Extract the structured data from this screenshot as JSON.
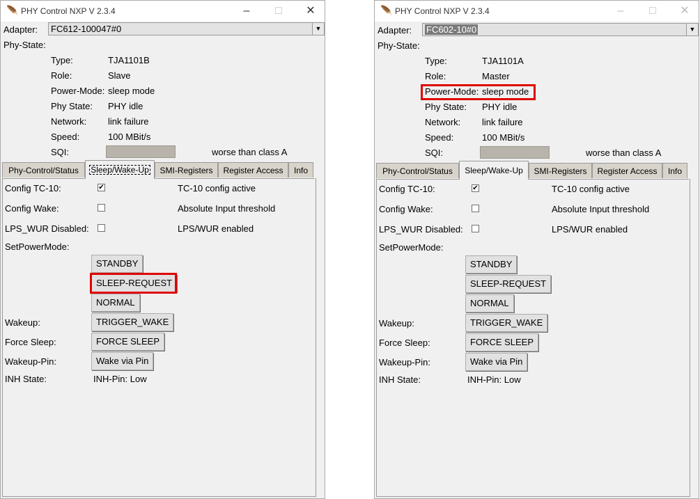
{
  "left": {
    "title": "PHY Control NXP V 2.3.4",
    "adapter_label": "Adapter:",
    "adapter_value": "FC612-100047#0",
    "phy_state_label": "Phy-State:",
    "type_label": "Type:",
    "type_value": "TJA1101B",
    "role_label": "Role:",
    "role_value": "Slave",
    "power_label": "Power-Mode:",
    "power_value": "sleep mode",
    "phystate_label": "Phy State:",
    "phystate_value": "PHY idle",
    "network_label": "Network:",
    "network_value": "link failure",
    "speed_label": "Speed:",
    "speed_value": "100 MBit/s",
    "sqi_label": "SQI:",
    "sqi_value": "worse than class A",
    "tabs": [
      "Phy-Control/Status",
      "Sleep/Wake-Up",
      "SMI-Registers",
      "Register Access",
      "Info"
    ],
    "config_tc10_label": "Config TC-10:",
    "config_tc10_status": "TC-10 config active",
    "config_wake_label": "Config Wake:",
    "config_wake_status": "Absolute Input threshold",
    "lps_label": "LPS_WUR Disabled:",
    "lps_status": "LPS/WUR enabled",
    "setpower_label": "SetPowerMode:",
    "btn_standby": "STANDBY",
    "btn_sleep_request": "SLEEP-REQUEST",
    "btn_normal": "NORMAL",
    "wakeup_label": "Wakeup:",
    "btn_trigger_wake": "TRIGGER_WAKE",
    "force_sleep_label": "Force Sleep:",
    "btn_force_sleep": "FORCE SLEEP",
    "wakeup_pin_label": "Wakeup-Pin:",
    "btn_wake_pin": "Wake via Pin",
    "inh_label": "INH State:",
    "inh_value": "INH-Pin: Low"
  },
  "right": {
    "title": "PHY Control NXP V 2.3.4",
    "adapter_label": "Adapter:",
    "adapter_value": "FC602-10#0",
    "phy_state_label": "Phy-State:",
    "type_label": "Type:",
    "type_value": "TJA1101A",
    "role_label": "Role:",
    "role_value": "Master",
    "power_label": "Power-Mode:",
    "power_value": "sleep mode",
    "phystate_label": "Phy State:",
    "phystate_value": "PHY idle",
    "network_label": "Network:",
    "network_value": "link failure",
    "speed_label": "Speed:",
    "speed_value": "100 MBit/s",
    "sqi_label": "SQI:",
    "sqi_value": "worse than class A",
    "tabs": [
      "Phy-Control/Status",
      "Sleep/Wake-Up",
      "SMI-Registers",
      "Register Access",
      "Info"
    ],
    "config_tc10_label": "Config TC-10:",
    "config_tc10_status": "TC-10 config active",
    "config_wake_label": "Config Wake:",
    "config_wake_status": "Absolute Input threshold",
    "lps_label": "LPS_WUR Disabled:",
    "lps_status": "LPS/WUR enabled",
    "setpower_label": "SetPowerMode:",
    "btn_standby": "STANDBY",
    "btn_sleep_request": "SLEEP-REQUEST",
    "btn_normal": "NORMAL",
    "wakeup_label": "Wakeup:",
    "btn_trigger_wake": "TRIGGER_WAKE",
    "force_sleep_label": "Force Sleep:",
    "btn_force_sleep": "FORCE SLEEP",
    "wakeup_pin_label": "Wakeup-Pin:",
    "btn_wake_pin": "Wake via Pin",
    "inh_label": "INH State:",
    "inh_value": "INH-Pin: Low"
  },
  "icons": {
    "app": "feather-icon",
    "minimize": "minimize-icon",
    "maximize": "maximize-icon",
    "close": "close-icon",
    "dropdown": "chevron-down-icon",
    "check": "checkmark-icon"
  },
  "colors": {
    "highlight": "#e00000",
    "window_bg": "#f0f0f0",
    "tab_bg": "#d8d4cc",
    "sqi_bar": "#b8b4ab"
  },
  "state": {
    "config_tc10_checked": true,
    "config_wake_checked": false,
    "lps_checked": false,
    "active_tab": "Sleep/Wake-Up"
  }
}
